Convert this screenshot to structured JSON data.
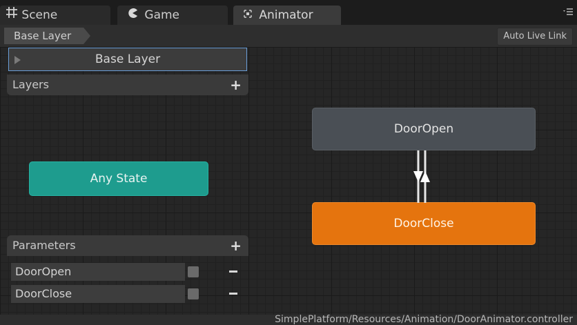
{
  "tabs": [
    {
      "label": "Scene",
      "icon": "grid-icon"
    },
    {
      "label": "Game",
      "icon": "pacman-icon"
    },
    {
      "label": "Animator",
      "icon": "animator-icon",
      "active": true
    }
  ],
  "breadcrumb": {
    "label": "Base Layer"
  },
  "toolbar": {
    "auto_live_link": "Auto Live Link"
  },
  "layers_panel": {
    "current_layer": "Base Layer",
    "header": "Layers",
    "add_label": "+"
  },
  "parameters_panel": {
    "header": "Parameters",
    "add_label": "+",
    "items": [
      {
        "name": "DoorOpen",
        "checked": false
      },
      {
        "name": "DoorClose",
        "checked": false
      }
    ]
  },
  "states": {
    "any_state": "Any State",
    "door_open": "DoorOpen",
    "door_close": "DoorClose"
  },
  "colors": {
    "any_state": "#1e9c8e",
    "default_state": "#e5740e",
    "state": "#4a4f55"
  },
  "status": {
    "path": "SimplePlatform/Resources/Animation/DoorAnimator.controller"
  }
}
